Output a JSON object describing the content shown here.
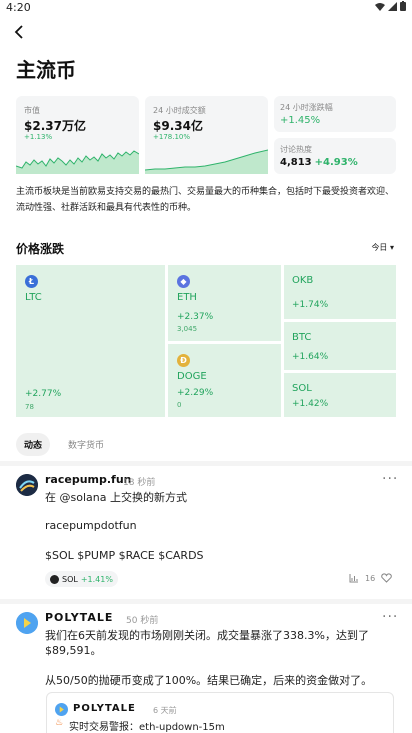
{
  "status_bar": {
    "time": "4:20"
  },
  "page": {
    "title": "主流币"
  },
  "cards": {
    "market_cap": {
      "label": "市值",
      "value": "$2.37万亿",
      "change": "+1.13%"
    },
    "volume_24h": {
      "label": "24 小时成交额",
      "value": "$9.34亿",
      "change": "+178.10%"
    },
    "change_24h": {
      "label": "24 小时涨跌幅",
      "value": "+1.45%"
    },
    "discussion": {
      "label": "讨论热度",
      "value": "4,813",
      "change": "+4.93%"
    }
  },
  "description": "主流币板块是当前欧易支持交易的最热门、交易量最大的币种集合，包括时下最受投资者欢迎、流动性强、社群活跃和最具有代表性的币种。",
  "price_section": {
    "title": "价格涨跌",
    "range": "今日"
  },
  "heatmap": {
    "ltc": {
      "name": "LTC",
      "change": "+2.77%",
      "volume": "78"
    },
    "eth": {
      "name": "ETH",
      "change": "+2.37%",
      "volume": "3,045"
    },
    "doge": {
      "name": "DOGE",
      "change": "+2.29%",
      "volume": "0"
    },
    "okb": {
      "name": "OKB",
      "change": "+1.74%"
    },
    "btc": {
      "name": "BTC",
      "change": "+1.64%"
    },
    "sol": {
      "name": "SOL",
      "change": "+1.42%"
    }
  },
  "tabs": [
    {
      "label": "动态"
    },
    {
      "label": "数字货币"
    }
  ],
  "posts": [
    {
      "author": "racepump.fun",
      "time": "18 秒前",
      "lines": [
        "在 @solana 上交换的新方式",
        "racepumpdotfun",
        "$SOL $PUMP $RACE $CARDS"
      ],
      "tag": {
        "symbol": "SOL",
        "change": "+1.41%"
      },
      "likes": "16"
    },
    {
      "author": "POLYTALE",
      "time": "50 秒前",
      "lines": [
        "我们在6天前发现的市场刚刚关闭。成交量暴涨了338.3%，达到了",
        "$89,591。",
        "从50/50的抛硬币变成了100%。结果已确定，后来的资金做对了。"
      ],
      "quote": {
        "author": "POLYTALE",
        "time": "6 天前",
        "text": "实时交易警报：eth-updown-15m"
      }
    }
  ],
  "colors": {
    "up": "#2fb36b",
    "tile_bg": "#dff2e5",
    "card_bg": "#f4f5f6"
  },
  "icons": [
    "back-arrow-icon",
    "wifi-icon",
    "signal-icon",
    "battery-icon",
    "more-icon",
    "chart-icon",
    "heart-icon",
    "fire-icon"
  ]
}
